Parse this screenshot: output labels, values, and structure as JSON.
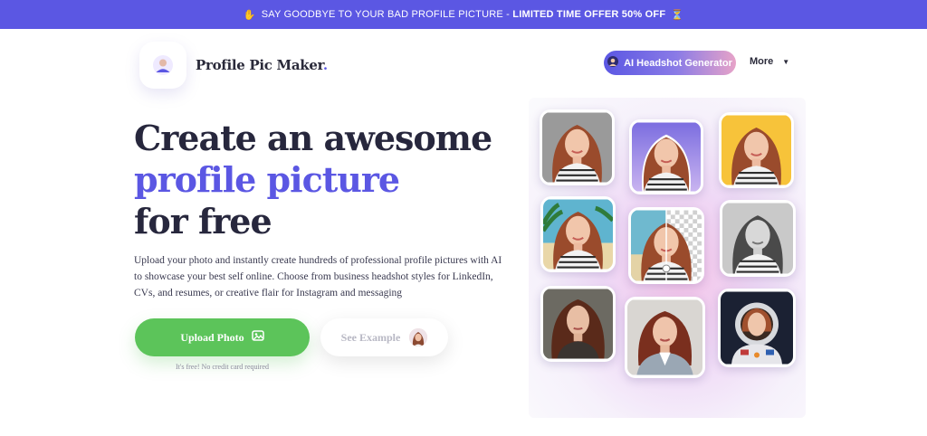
{
  "banner": {
    "emoji": "✋",
    "text": "SAY GOODBYE TO YOUR BAD PROFILE PICTURE - ",
    "offer": "LIMITED TIME OFFER 50% OFF",
    "hourglass": "⏳"
  },
  "header": {
    "logo_text": "Profile Pic Maker",
    "logo_dot": ".",
    "ai_button": "AI Headshot Generator",
    "more_label": "More",
    "more_caret": "▼"
  },
  "hero": {
    "title_line1": "Create an awesome",
    "title_line2": "profile picture",
    "title_line3": "for free",
    "description": "Upload your photo and instantly create hundreds of professional profile pictures with AI to showcase your best self online. Choose from business headshot styles for LinkedIn, CVs, and resumes, or creative flair for Instagram and messaging",
    "upload_label": "Upload Photo",
    "free_note": "It's free! No credit card required",
    "example_label": "See Example"
  },
  "colors": {
    "brand": "#5b57e3",
    "upload": "#5cc45a"
  },
  "gallery": {
    "tiles": [
      {
        "name": "gallery-tile-gray-bg",
        "bg": "#9a9a9a"
      },
      {
        "name": "gallery-tile-purple-bg",
        "bg": "#8d7fe0"
      },
      {
        "name": "gallery-tile-yellow-bg",
        "bg": "#f7c33a"
      },
      {
        "name": "gallery-tile-beach-bg",
        "bg": "#5fb4cf"
      },
      {
        "name": "gallery-tile-transparent-compare",
        "bg": "#dcdcdc"
      },
      {
        "name": "gallery-tile-black-white",
        "bg": "#c9c9c9"
      },
      {
        "name": "gallery-tile-ai-portrait",
        "bg": "#6c6a62"
      },
      {
        "name": "gallery-tile-business-headshot",
        "bg": "#d9d6d2"
      },
      {
        "name": "gallery-tile-astronaut",
        "bg": "#1b2133"
      }
    ]
  }
}
